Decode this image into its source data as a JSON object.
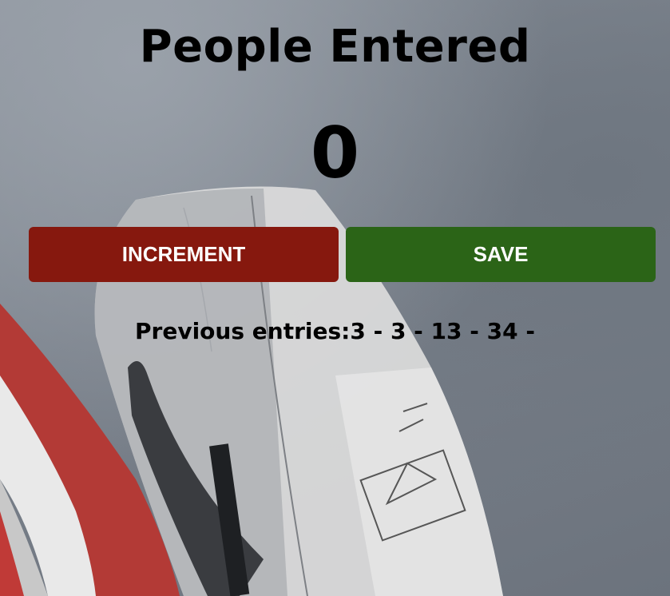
{
  "header": {
    "title": "People Entered"
  },
  "counter": {
    "value": "0"
  },
  "buttons": {
    "increment_label": "INCREMENT",
    "save_label": "SAVE"
  },
  "entries": {
    "label": "Previous entries:",
    "values_text": "3 - 3 - 13 - 34 -"
  },
  "colors": {
    "increment_button": "#86180e",
    "save_button": "#2b6417",
    "text": "#000000"
  }
}
